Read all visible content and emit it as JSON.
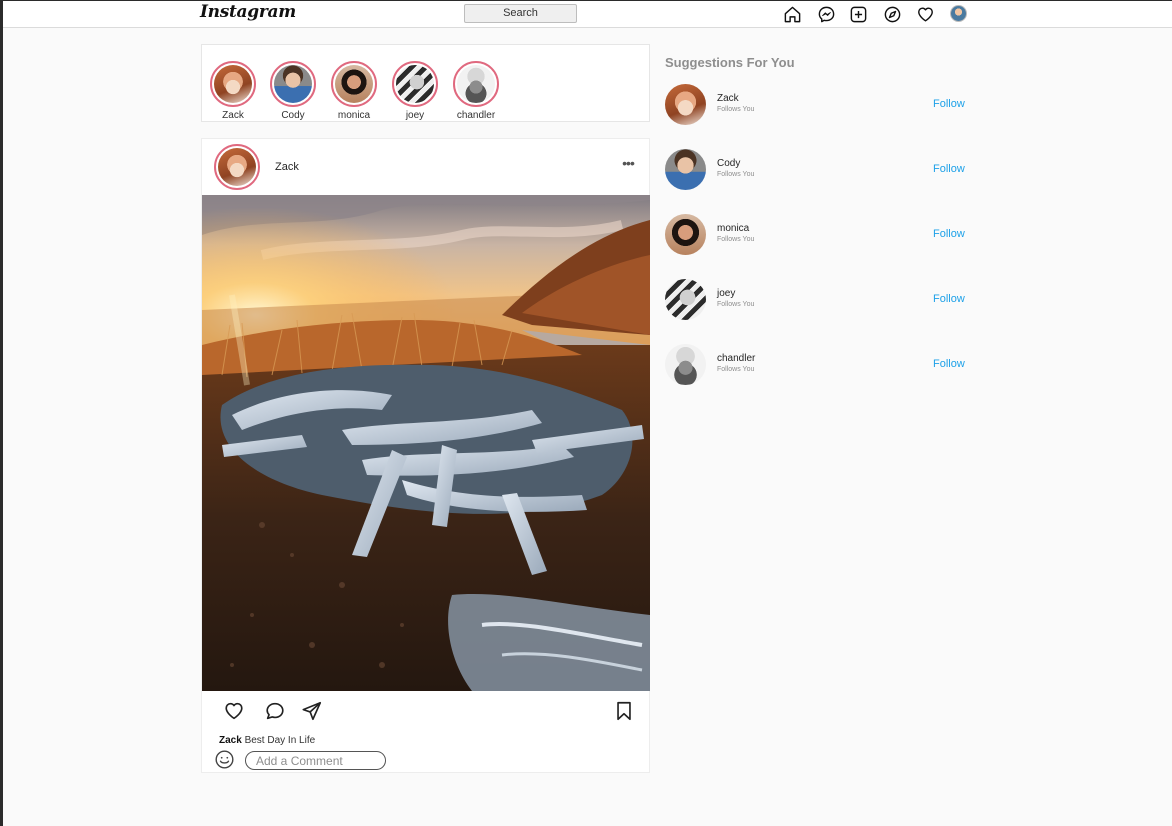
{
  "navbar": {
    "logo": "Instagram",
    "search_label": "Search",
    "icons": [
      "home-icon",
      "messenger-icon",
      "new-post-icon",
      "explore-icon",
      "activity-heart-icon",
      "profile-avatar"
    ]
  },
  "stories": [
    {
      "name": "Zack"
    },
    {
      "name": "Cody"
    },
    {
      "name": "monica"
    },
    {
      "name": "joey"
    },
    {
      "name": "chandler"
    }
  ],
  "post": {
    "username": "Zack",
    "more_icon": "•••",
    "caption_user": "Zack",
    "caption_text": " Best Day In Life",
    "comment_placeholder": "Add a Comment"
  },
  "suggestions": {
    "title": "Suggestions For You",
    "items": [
      {
        "name": "Zack",
        "subtitle": "Follows You",
        "action": "Follow"
      },
      {
        "name": "Cody",
        "subtitle": "Follows You",
        "action": "Follow"
      },
      {
        "name": "monica",
        "subtitle": "Follows You",
        "action": "Follow"
      },
      {
        "name": "joey",
        "subtitle": "Follows You",
        "action": "Follow"
      },
      {
        "name": "chandler",
        "subtitle": "Follows You",
        "action": "Follow"
      }
    ]
  },
  "colors": {
    "accent": "#1ea1e8",
    "story_ring": "#e0697f",
    "background": "#fafafa"
  }
}
